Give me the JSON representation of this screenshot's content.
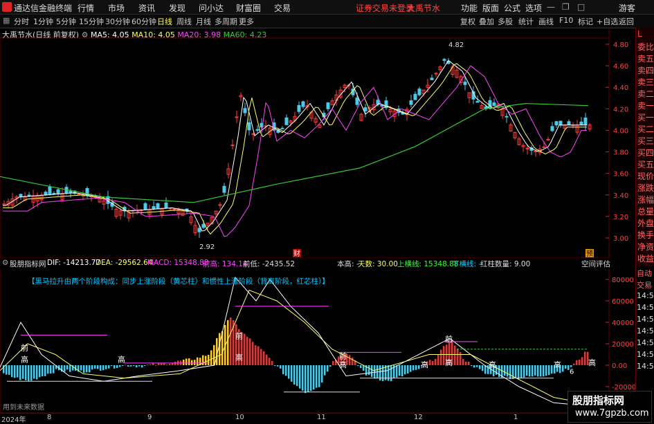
{
  "titlebar": {
    "app_name": "通达信金融终端",
    "menus": [
      "行情",
      "市场",
      "资讯",
      "发现",
      "问小达",
      "财富圈",
      "交易"
    ],
    "status": "证券交易未登录",
    "stock": "大禹节水",
    "right_menus": [
      "功能",
      "版面",
      "公式",
      "选项"
    ],
    "guest": "游客"
  },
  "toolbar": {
    "periods": [
      "分时",
      "1分钟",
      "5分钟",
      "15分钟",
      "30分钟",
      "60分钟",
      "日线",
      "周线",
      "月线",
      "多周期",
      "更多"
    ],
    "active_period": "日线",
    "right_tools": [
      "复权",
      "叠加",
      "多股",
      "统计",
      "画线",
      "F10",
      "标记",
      "+自选",
      "返回"
    ]
  },
  "chart_header": {
    "title": "大禹节水(日线 前复权)",
    "ma5": "MA5: 4.05",
    "ma10": "MA10: 4.05",
    "ma20": "MA20: 3.98",
    "ma60": "MA60: 4.23"
  },
  "colors": {
    "up": "#ff3b3b",
    "down": "#4ec9e8",
    "ma5": "#ffffff",
    "ma10": "#ffff66",
    "ma20": "#ff44ff",
    "ma60": "#33cc33",
    "accent": "#ff3333"
  },
  "price_axis": [
    "4.80",
    "4.60",
    "4.40",
    "4.20",
    "4.00",
    "3.80",
    "3.60",
    "3.40",
    "3.20",
    "3.00"
  ],
  "annotations": {
    "high": "4.82",
    "low": "2.92",
    "cai": "财",
    "yu": "预"
  },
  "sidebar": [
    "L",
    "委比",
    "卖五",
    "卖四",
    "卖三",
    "卖二",
    "卖一",
    "买一",
    "买二",
    "买三",
    "买四",
    "买五",
    "现价",
    "涨跌",
    "涨幅",
    "总量",
    "外盘",
    "换手",
    "净资",
    "收益"
  ],
  "sidebar2": [
    "自动",
    "交易",
    "14:56",
    "14:56",
    "14:56",
    "14:56",
    "14:56",
    "14:56",
    "14:56"
  ],
  "indicator": {
    "name": "股朋指标网",
    "dif": "DIF: -14213.77",
    "dea": "DEA: -29562.64",
    "macd": "MACD: 15348.88",
    "qiangao": "前高: 134.14",
    "qiandi": "前低: -2435.52",
    "bengao": "本高: -",
    "tianshu": "天数: 30.00",
    "shanghengxian": "上横线: 15348.88",
    "xiahengxian": "下横线: -",
    "hongzhu": "红柱数量: 9.00",
    "kongjian": "空间评估",
    "desc": "【黑马拉升由两个阶段构成：同步上涨阶段（黄芯柱）和惯性上涨阶段（背离阶段，红芯柱）】",
    "footer": "用到未来数据",
    "axis": [
      "80000",
      "60000",
      "40000",
      "20000",
      "0.00",
      "-20000"
    ],
    "labels_qian": "前",
    "labels_gao": "高",
    "label_six": "6"
  },
  "xaxis": [
    "2024年",
    "8",
    "9",
    "10",
    "11",
    "12",
    "1"
  ],
  "watermark": {
    "title": "股朋指标网",
    "url": "www.7gpzb.com"
  }
}
